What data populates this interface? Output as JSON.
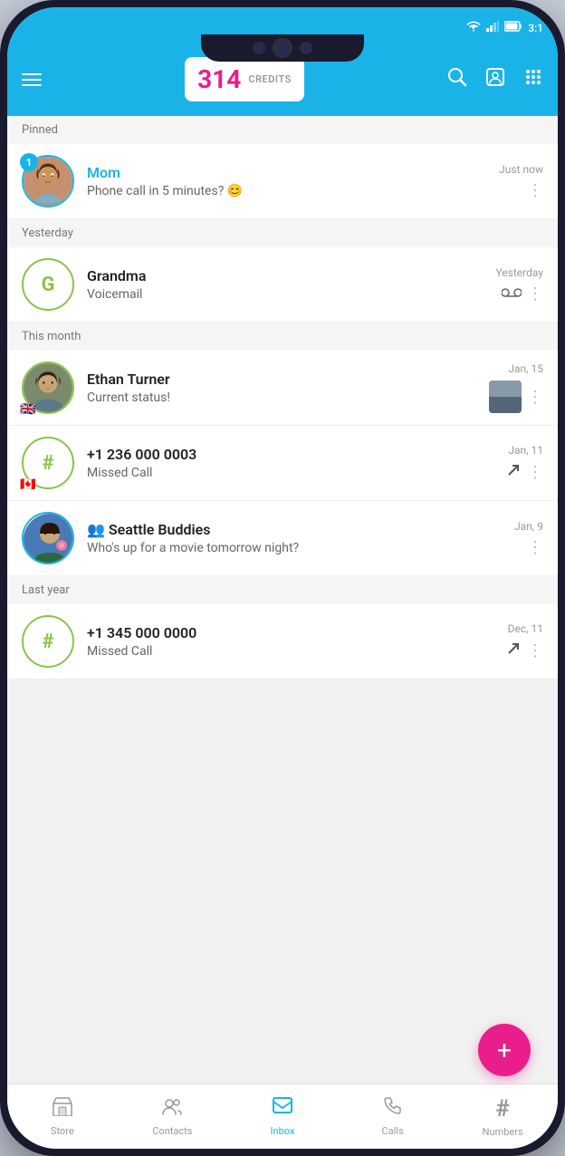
{
  "statusBar": {
    "time": "3:1",
    "wifi": "▲",
    "signal": "▲",
    "battery": "▪"
  },
  "header": {
    "creditsNumber": "314",
    "creditsLabel": "CREDITS",
    "menuAriaLabel": "Menu"
  },
  "sections": [
    {
      "label": "Pinned",
      "items": [
        {
          "id": "mom",
          "name": "Mom",
          "nameColor": "blue",
          "preview": "Phone call in 5 minutes? 😊",
          "time": "Just now",
          "badge": "1",
          "avatarType": "photo-mom",
          "hasFlag": false
        }
      ]
    },
    {
      "label": "Yesterday",
      "items": [
        {
          "id": "grandma",
          "name": "Grandma",
          "nameColor": "dark",
          "preview": "Voicemail",
          "time": "Yesterday",
          "badge": null,
          "avatarType": "initial",
          "initial": "G",
          "hasFlag": false,
          "actionIcon": "voicemail"
        }
      ]
    },
    {
      "label": "This month",
      "items": [
        {
          "id": "ethan",
          "name": "Ethan Turner",
          "nameColor": "dark",
          "preview": "Current status!",
          "time": "Jan, 15",
          "badge": null,
          "avatarType": "photo-ethan",
          "hasFlag": true,
          "flagEmoji": "🇬🇧",
          "actionIcon": "thumb"
        },
        {
          "id": "number1",
          "name": "+1 236 000 0003",
          "nameColor": "dark",
          "preview": "Missed Call",
          "time": "Jan, 11",
          "badge": null,
          "avatarType": "initial-hash",
          "initial": "#",
          "hasFlag": true,
          "flagEmoji": "🇨🇦",
          "actionIcon": "missed"
        },
        {
          "id": "seattle",
          "name": "Seattle Buddies",
          "nameColor": "dark",
          "preview": "Who's up for a movie tomorrow night?",
          "time": "Jan, 9",
          "badge": null,
          "avatarType": "photo-seattle",
          "hasFlag": false,
          "isGroup": true,
          "actionIcon": "none"
        }
      ]
    },
    {
      "label": "Last year",
      "items": [
        {
          "id": "number2",
          "name": "+1 345 000 0000",
          "nameColor": "dark",
          "preview": "Missed Call",
          "time": "Dec, 11",
          "badge": null,
          "avatarType": "initial-hash",
          "initial": "#",
          "hasFlag": false,
          "actionIcon": "missed",
          "partial": true
        }
      ]
    }
  ],
  "fab": {
    "label": "+"
  },
  "bottomNav": {
    "items": [
      {
        "id": "store",
        "label": "Store",
        "icon": "🏪",
        "active": false
      },
      {
        "id": "contacts",
        "label": "Contacts",
        "icon": "👥",
        "active": false
      },
      {
        "id": "inbox",
        "label": "Inbox",
        "icon": "💬",
        "active": true
      },
      {
        "id": "calls",
        "label": "Calls",
        "icon": "📞",
        "active": false
      },
      {
        "id": "numbers",
        "label": "Numbers",
        "icon": "#",
        "active": false
      }
    ]
  }
}
